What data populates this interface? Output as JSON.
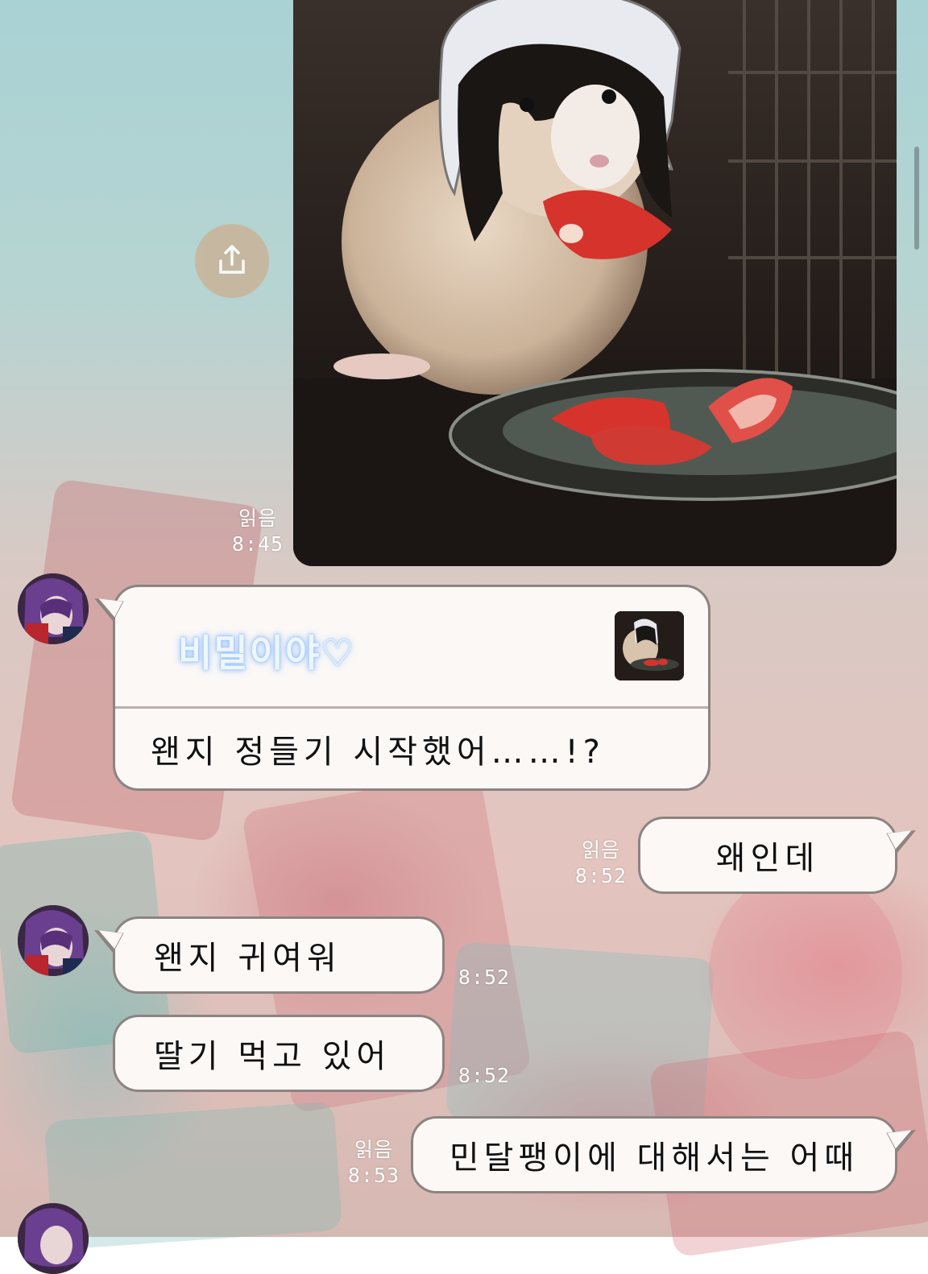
{
  "background": {
    "theme": "pastel-popsicle-wallpaper",
    "accent": "#c8b59b"
  },
  "share_button": {
    "icon": "share-icon"
  },
  "image_message": {
    "description_icon": "photo",
    "read_label": "읽음",
    "time": "8:45"
  },
  "messages": [
    {
      "side": "incoming",
      "reply": {
        "title": "비밀이야♡"
      },
      "text": "왠지 정들기 시작했어……!?"
    },
    {
      "side": "outgoing",
      "read_label": "읽음",
      "time": "8:52",
      "text": "왜인데"
    },
    {
      "side": "incoming",
      "time": "8:52",
      "text": "왠지 귀여워"
    },
    {
      "side": "incoming",
      "time": "8:52",
      "text": "딸기 먹고 있어"
    },
    {
      "side": "outgoing",
      "read_label": "읽음",
      "time": "8:53",
      "text": "민달팽이에 대해서는 어때"
    }
  ]
}
